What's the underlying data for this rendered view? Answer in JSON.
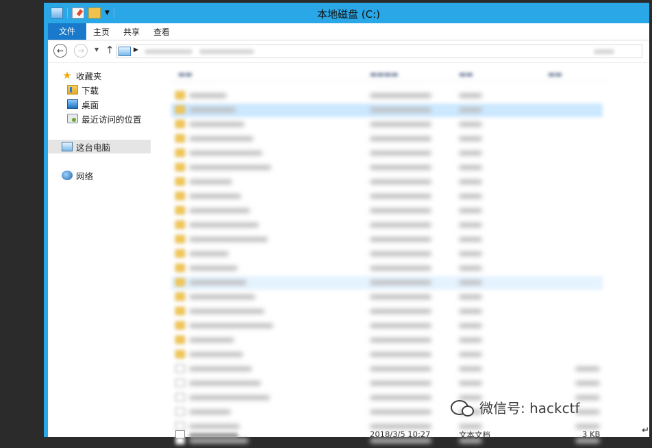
{
  "window": {
    "title": "本地磁盘 (C:)"
  },
  "ribbon": {
    "tabs": [
      "文件",
      "主页",
      "共享",
      "查看"
    ]
  },
  "navpane": {
    "favorites_label": "收藏夹",
    "favorites": [
      "下载",
      "桌面",
      "最近访问的位置"
    ],
    "this_pc": "这台电脑",
    "network": "网络"
  },
  "visible_row": {
    "date": "2018/3/5 10:27",
    "type": "文本文档",
    "size": "3 KB"
  },
  "watermark": {
    "text": "微信号: hackctf"
  },
  "colors": {
    "titlebar": "#2aa7e6",
    "file_tab": "#1979ca",
    "selected_row": "#cce8ff"
  }
}
